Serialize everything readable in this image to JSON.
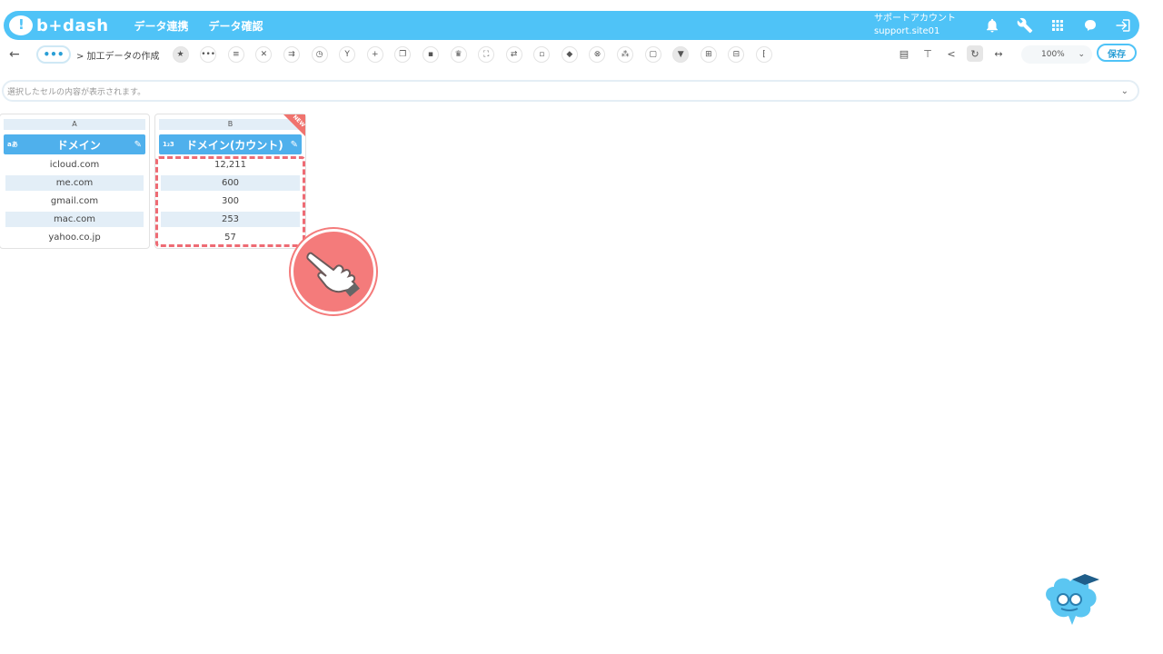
{
  "header": {
    "logo_text": "b+dash",
    "nav": [
      "データ連携",
      "データ確認"
    ],
    "account_name": "サポートアカウント",
    "account_site": "support.site01",
    "icons": [
      "bell-icon",
      "wrench-icon",
      "apps-grid-icon",
      "brain-icon",
      "logout-icon"
    ]
  },
  "toolbar": {
    "back": "←",
    "more": "•••",
    "breadcrumb": "> 加工データの作成",
    "tool_icons": [
      "star-icon",
      "more-icon",
      "list-icon",
      "tools-icon",
      "merge-icon",
      "timer-icon",
      "branch-icon",
      "plus-icon",
      "copy-icon",
      "trash-icon",
      "crown-icon",
      "expand-icon",
      "swap-icon",
      "lock-icon",
      "box-icon",
      "close-circle-icon",
      "scatter-icon",
      "frame-icon",
      "filter-icon",
      "calc-icon",
      "grid-icon",
      "bracket-icon"
    ],
    "right_icons": [
      "clipboard-icon",
      "hierarchy-icon",
      "share-icon",
      "refresh-icon",
      "code-icon"
    ],
    "zoom_value": "100%",
    "save_label": "保存"
  },
  "formula_bar": {
    "placeholder": "選択したセルの内容が表示されます。"
  },
  "columns": [
    {
      "letter": "A",
      "type_icon": "a-text-type-icon",
      "type_label": "aあ",
      "name": "ドメイン",
      "cells": [
        "icloud.com",
        "me.com",
        "gmail.com",
        "mac.com",
        "yahoo.co.jp"
      ]
    },
    {
      "letter": "B",
      "type_icon": "number-type-icon",
      "type_label": "1₂3",
      "name": "ドメイン(カウント)",
      "badge": "NEW",
      "cells": [
        "12,211",
        "600",
        "300",
        "253",
        "57"
      ]
    }
  ],
  "colors": {
    "header_bg": "#4fc3f7",
    "column_header_bg": "#4fb0ec",
    "highlight": "#ee6b74",
    "hand_marker": "#f47b7b"
  }
}
